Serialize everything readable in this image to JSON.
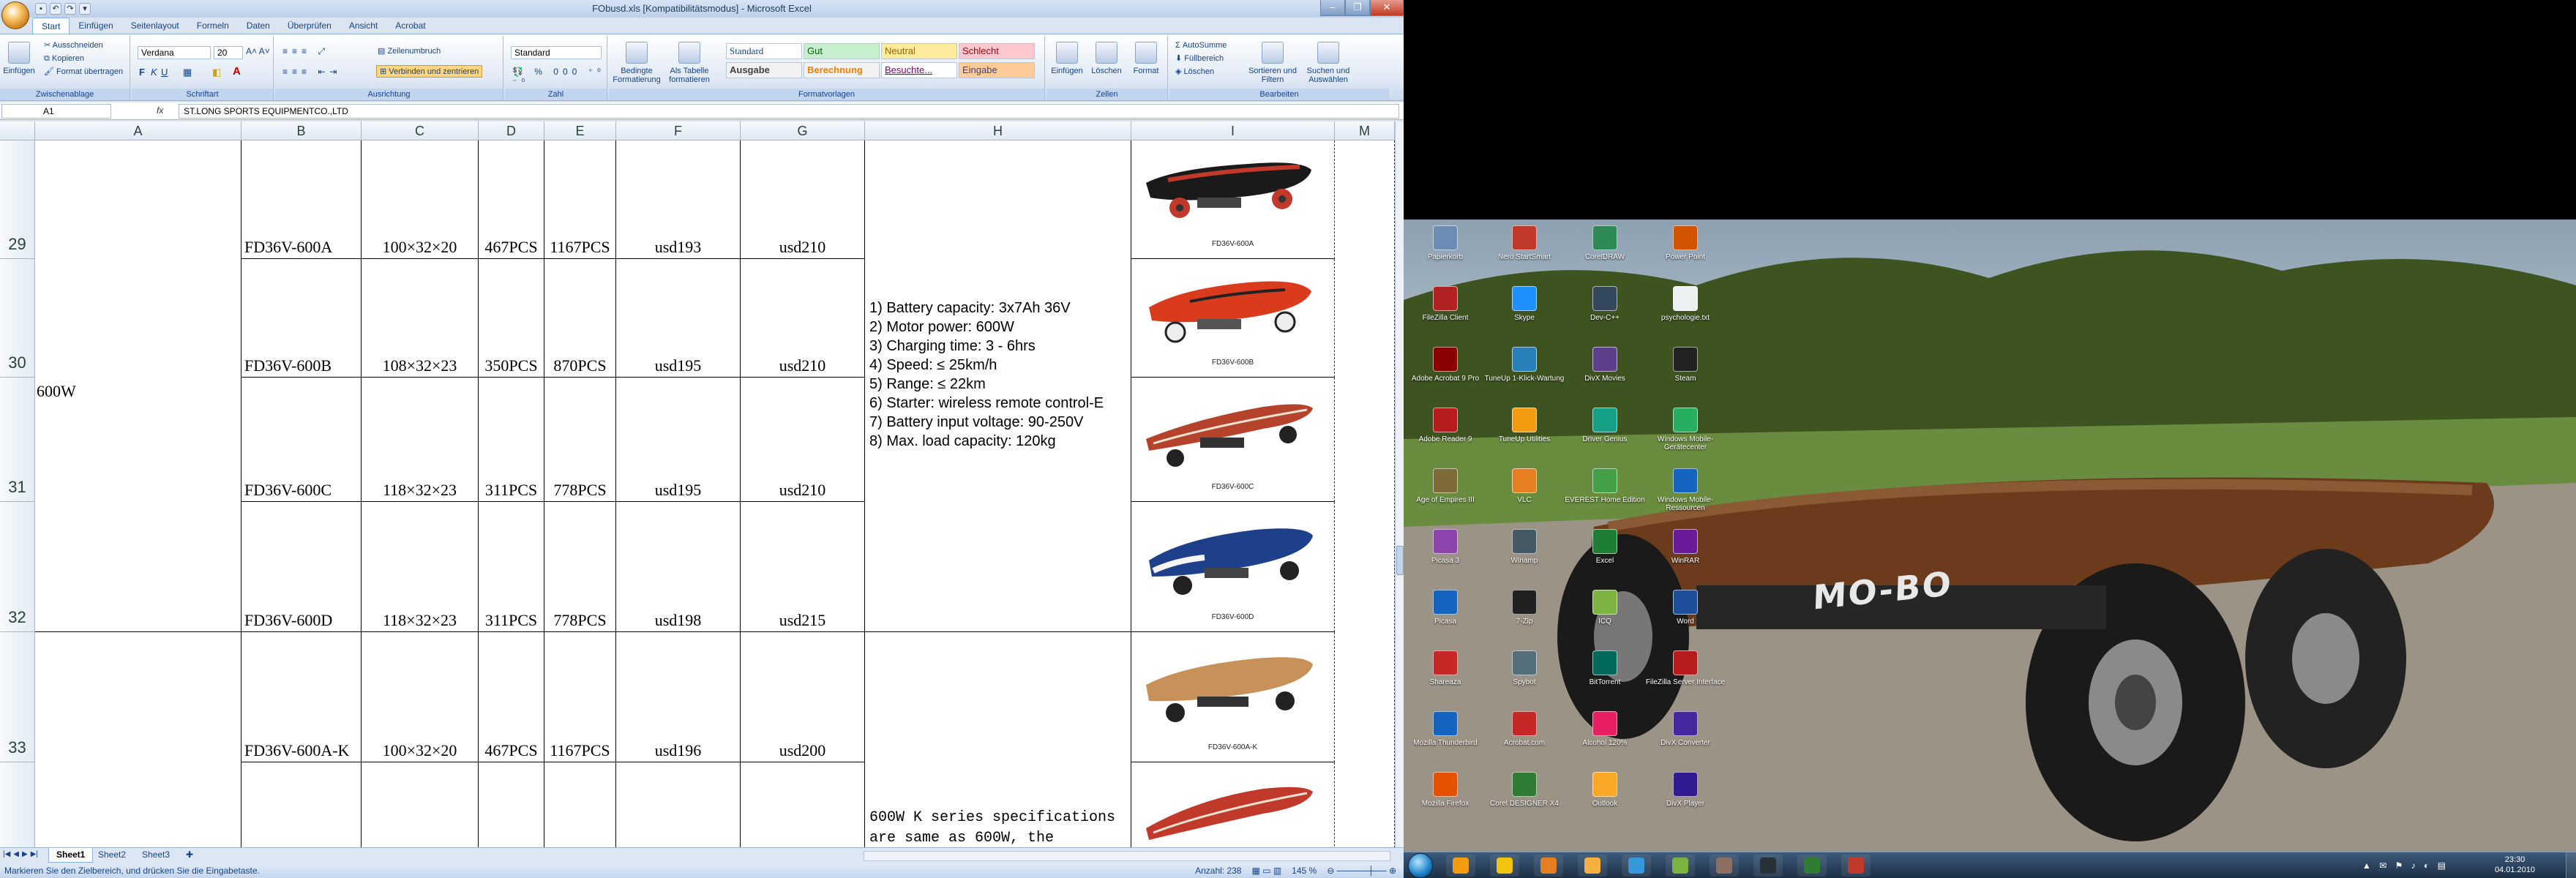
{
  "excel": {
    "window_title": "FObusd.xls  [Kompatibilitätsmodus] - Microsoft Excel",
    "tabs": [
      "Start",
      "Einfügen",
      "Seitenlayout",
      "Formeln",
      "Daten",
      "Überprüfen",
      "Ansicht",
      "Acrobat"
    ],
    "ribbon": {
      "clipboard": {
        "paste": "Einfügen",
        "cut": "Ausschneiden",
        "copy": "Kopieren",
        "format_painter": "Format übertragen",
        "label": "Zwischenablage"
      },
      "font": {
        "name": "Verdana",
        "size": "20",
        "label": "Schriftart"
      },
      "alignment": {
        "wrap": "Zeilenumbruch",
        "merge": "Verbinden und zentrieren",
        "label": "Ausrichtung"
      },
      "number": {
        "format": "Standard",
        "label": "Zahl"
      },
      "styles": {
        "conditional": "Bedingte Formatierung",
        "as_table": "Als Tabelle formatieren",
        "standard": "Standard",
        "gut": "Gut",
        "neutral": "Neutral",
        "schlecht": "Schlecht",
        "ausgabe": "Ausgabe",
        "berechnung": "Berechnung",
        "besucht": "Besuchte...",
        "eingabe": "Eingabe",
        "label": "Formatvorlagen"
      },
      "cells": {
        "insert": "Einfügen",
        "delete": "Löschen",
        "format": "Format",
        "label": "Zellen"
      },
      "editing": {
        "autosum": "AutoSumme",
        "fill": "Füllbereich",
        "clear": "Löschen",
        "sort": "Sortieren und Filtern",
        "find": "Suchen und Auswählen",
        "label": "Bearbeiten"
      }
    },
    "name_box": "A1",
    "formula": "ST.LONG SPORTS EQUIPMENTCO.,LTD",
    "columns": [
      "A",
      "B",
      "C",
      "D",
      "E",
      "F",
      "G",
      "H",
      "I",
      "M"
    ],
    "group_label": "600W",
    "rows": [
      {
        "num": "29",
        "model": "FD36V-600A",
        "size": "100×32×20",
        "qty1": "467PCS",
        "qty2": "1167PCS",
        "p1": "usd193",
        "p2": "usd210",
        "img_caption": "FD36V-600A"
      },
      {
        "num": "30",
        "model": "FD36V-600B",
        "size": "108×32×23",
        "qty1": "350PCS",
        "qty2": "870PCS",
        "p1": "usd195",
        "p2": "usd210",
        "img_caption": "FD36V-600B"
      },
      {
        "num": "31",
        "model": "FD36V-600C",
        "size": "118×32×23",
        "qty1": "311PCS",
        "qty2": "778PCS",
        "p1": "usd195",
        "p2": "usd210",
        "img_caption": "FD36V-600C"
      },
      {
        "num": "32",
        "model": "FD36V-600D",
        "size": "118×32×23",
        "qty1": "311PCS",
        "qty2": "778PCS",
        "p1": "usd198",
        "p2": "usd215",
        "img_caption": "FD36V-600D"
      },
      {
        "num": "33",
        "model": "FD36V-600A-K",
        "size": "100×32×20",
        "qty1": "467PCS",
        "qty2": "1167PCS",
        "p1": "usd196",
        "p2": "usd200",
        "img_caption": "FD36V-600A-K"
      },
      {
        "num": "34",
        "model": "",
        "size": "",
        "qty1": "",
        "qty2": "",
        "p1": "",
        "p2": "",
        "img_caption": ""
      }
    ],
    "spec_lines": [
      "1) Battery capacity: 3x7Ah 36V",
      "2) Motor power: 600W",
      "3) Charging time: 3 - 6hrs",
      "4) Speed: ≤ 25km/h",
      "5) Range: ≤ 22km",
      "6) Starter: wireless remote control-E",
      "7) Battery input voltage: 90-250V",
      "8) Max. load capacity: 120kg"
    ],
    "spec2": "600W K series specifications are same as 600W, the",
    "sheets": [
      "Sheet1",
      "Sheet2",
      "Sheet3"
    ],
    "status": "Markieren Sie den Zielbereich, und drücken Sie die Eingabetaste.",
    "status_count": "Anzahl: 238",
    "zoom": "145 %"
  },
  "desktop": {
    "icons": [
      {
        "label": "Papierkorb",
        "color": "#6b8db5"
      },
      {
        "label": "Nero StartSmart",
        "color": "#c0392b"
      },
      {
        "label": "CorelDRAW",
        "color": "#2e8b57"
      },
      {
        "label": "Power Point",
        "color": "#d35400"
      },
      {
        "label": "FileZilla Client",
        "color": "#b22222"
      },
      {
        "label": "Skype",
        "color": "#1e90ff"
      },
      {
        "label": "Dev-C++",
        "color": "#34495e"
      },
      {
        "label": "psychologie.txt",
        "color": "#ecf0f1"
      },
      {
        "label": "Adobe Acrobat 9 Pro",
        "color": "#8b0000"
      },
      {
        "label": "TuneUp 1-Klick-Wartung",
        "color": "#2980b9"
      },
      {
        "label": "DivX Movies",
        "color": "#5d3f8c"
      },
      {
        "label": "Steam",
        "color": "#222222"
      },
      {
        "label": "Adobe Reader 9",
        "color": "#b71c1c"
      },
      {
        "label": "TuneUp Utilities",
        "color": "#f39c12"
      },
      {
        "label": "Driver Genius",
        "color": "#16a085"
      },
      {
        "label": "Windows Mobile-Gerätecenter",
        "color": "#27ae60"
      },
      {
        "label": "Age of Empires III",
        "color": "#7f6a3a"
      },
      {
        "label": "VLC",
        "color": "#e67e22"
      },
      {
        "label": "EVEREST Home Edition",
        "color": "#43a047"
      },
      {
        "label": "Windows Mobile-Ressourcen",
        "color": "#1565c0"
      },
      {
        "label": "Picasa 3",
        "color": "#8e44ad"
      },
      {
        "label": "Winamp",
        "color": "#455a64"
      },
      {
        "label": "Excel",
        "color": "#1e7e34"
      },
      {
        "label": "WinRAR",
        "color": "#6a1b9a"
      },
      {
        "label": "Picasa",
        "color": "#1565c0"
      },
      {
        "label": "7-Zip",
        "color": "#212121"
      },
      {
        "label": "ICQ",
        "color": "#7cb342"
      },
      {
        "label": "Word",
        "color": "#1f4e9c"
      },
      {
        "label": "Shareaza",
        "color": "#c62828"
      },
      {
        "label": "Spybot",
        "color": "#546e7a"
      },
      {
        "label": "BitTorrent",
        "color": "#00695c"
      },
      {
        "label": "FileZilla Server Interface",
        "color": "#b71c1c"
      },
      {
        "label": "Mozilla Thunderbird",
        "color": "#1565c0"
      },
      {
        "label": "Acrobat.com",
        "color": "#c62828"
      },
      {
        "label": "Alcohol 120%",
        "color": "#e91e63"
      },
      {
        "label": "DivX Converter",
        "color": "#4527a0"
      },
      {
        "label": "Mozilla Firefox",
        "color": "#e65100"
      },
      {
        "label": "Corel DESIGNER X4",
        "color": "#2e7d32"
      },
      {
        "label": "Outlook",
        "color": "#f9a825"
      },
      {
        "label": "DivX Player",
        "color": "#311b92"
      }
    ],
    "taskbar_apps": [
      {
        "name": "VLC",
        "color": "#f39c12"
      },
      {
        "name": "Explorer",
        "color": "#f1c40f"
      },
      {
        "name": "Firefox",
        "color": "#e67e22"
      },
      {
        "name": "Outlook",
        "color": "#f5b041"
      },
      {
        "name": "Skype",
        "color": "#3498db"
      },
      {
        "name": "ICQ",
        "color": "#7cb342"
      },
      {
        "name": "Age of Empires",
        "color": "#8d6e63"
      },
      {
        "name": "Steam",
        "color": "#263238"
      },
      {
        "name": "Excel",
        "color": "#2e7d32"
      },
      {
        "name": "FileZilla",
        "color": "#c0392b"
      }
    ],
    "clock_time": "23:30",
    "clock_date": "04.01.2010",
    "board_brand": "MO-BO"
  }
}
